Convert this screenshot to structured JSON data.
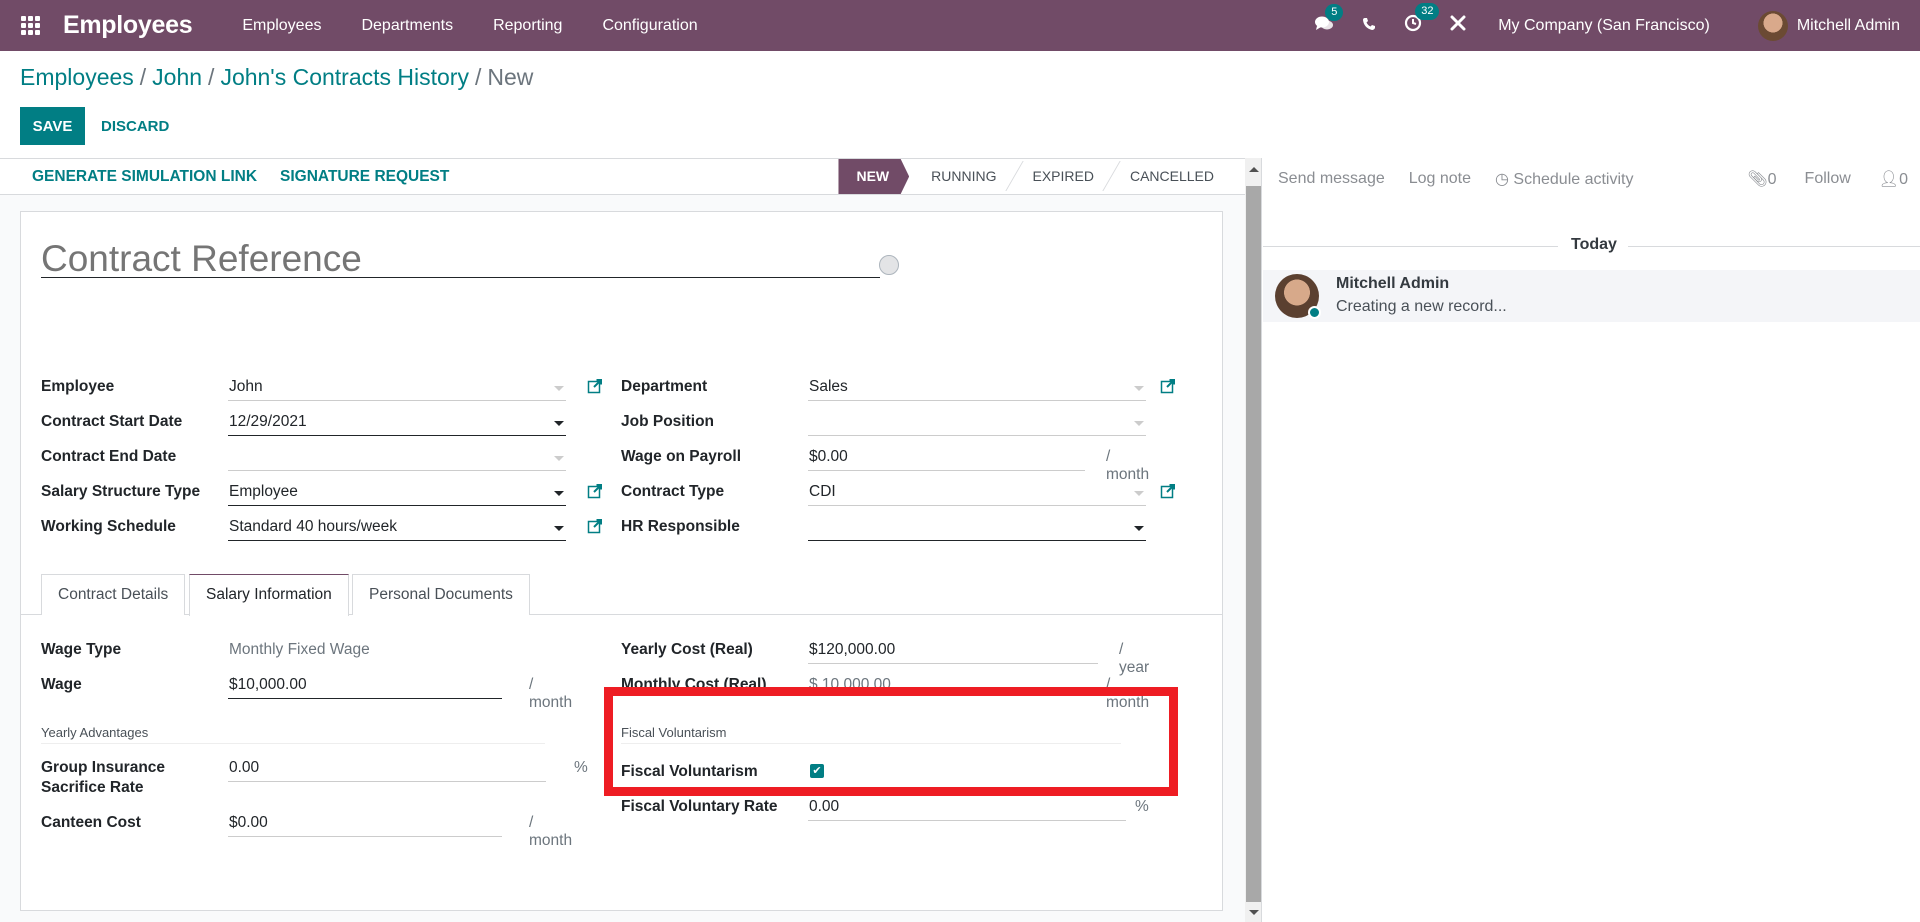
{
  "navbar": {
    "app_title": "Employees",
    "menu": [
      "Employees",
      "Departments",
      "Reporting",
      "Configuration"
    ],
    "messages_badge": "5",
    "activities_badge": "32",
    "company": "My Company (San Francisco)",
    "user": "Mitchell Admin",
    "accent_color": "#714b67"
  },
  "breadcrumb": {
    "items": [
      "Employees",
      "John",
      "John's Contracts History"
    ],
    "current": "New"
  },
  "actions": {
    "save": "SAVE",
    "discard": "DISCARD"
  },
  "statusbar": {
    "buttons": [
      "GENERATE SIMULATION LINK",
      "SIGNATURE REQUEST"
    ],
    "stages": [
      "NEW",
      "RUNNING",
      "EXPIRED",
      "CANCELLED"
    ],
    "active_stage": "NEW"
  },
  "form": {
    "title_placeholder": "Contract Reference",
    "left_fields": [
      {
        "label": "Employee",
        "value": "John"
      },
      {
        "label": "Contract Start Date",
        "value": "12/29/2021"
      },
      {
        "label": "Contract End Date",
        "value": ""
      },
      {
        "label": "Salary Structure Type",
        "value": "Employee"
      },
      {
        "label": "Working Schedule",
        "value": "Standard 40 hours/week"
      }
    ],
    "right_fields": [
      {
        "label": "Department",
        "value": "Sales"
      },
      {
        "label": "Job Position",
        "value": ""
      },
      {
        "label": "Wage on Payroll",
        "value": "$0.00",
        "unit": "/ month"
      },
      {
        "label": "Contract Type",
        "value": "CDI"
      },
      {
        "label": "HR Responsible",
        "value": ""
      }
    ],
    "tabs": [
      "Contract Details",
      "Salary Information",
      "Personal Documents"
    ],
    "active_tab": "Salary Information",
    "salary": {
      "wage_type_label": "Wage Type",
      "wage_type_value": "Monthly Fixed Wage",
      "wage_label": "Wage",
      "wage_value": "$10,000.00",
      "wage_unit": "/ month",
      "yearly_cost_label": "Yearly Cost (Real)",
      "yearly_cost_value": "$120,000.00",
      "yearly_cost_unit": "/ year",
      "monthly_cost_label": "Monthly Cost (Real)",
      "monthly_cost_value": "$ 10,000.00",
      "monthly_cost_unit": "/ month",
      "yearly_advantages_title": "Yearly Advantages",
      "group_insurance_label": "Group Insurance Sacrifice Rate",
      "group_insurance_value": "0.00",
      "group_insurance_unit": "%",
      "canteen_label": "Canteen Cost",
      "canteen_value": "$0.00",
      "canteen_unit": "/ month",
      "fiscal_title": "Fiscal Voluntarism",
      "fiscal_voluntarism_label": "Fiscal Voluntarism",
      "fiscal_voluntarism_checked": true,
      "fiscal_rate_label": "Fiscal Voluntary Rate",
      "fiscal_rate_value": "0.00",
      "fiscal_rate_unit": "%"
    }
  },
  "chatter": {
    "send_message": "Send message",
    "log_note": "Log note",
    "schedule_activity": "Schedule activity",
    "attachments_count": "0",
    "follow": "Follow",
    "followers_count": "0",
    "date_separator": "Today",
    "messages": [
      {
        "author": "Mitchell Admin",
        "body": "Creating a new record..."
      }
    ]
  },
  "highlight_color": "#ee1d23"
}
